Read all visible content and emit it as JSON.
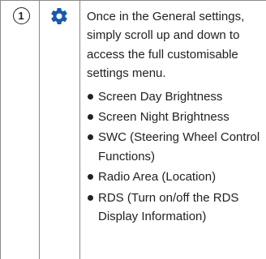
{
  "step": {
    "number": "1"
  },
  "icon": {
    "name": "gear-icon",
    "color": "#1a5aa8"
  },
  "content": {
    "intro": "Once in the General settings, simply scroll up and down to access the full customisable settings menu.",
    "bullets": [
      "Screen Day Brightness",
      "Screen Night Brightness",
      "SWC (Steering Wheel Control Functions)",
      "Radio Area (Location)",
      "RDS (Turn on/off the RDS Display Information)"
    ]
  }
}
